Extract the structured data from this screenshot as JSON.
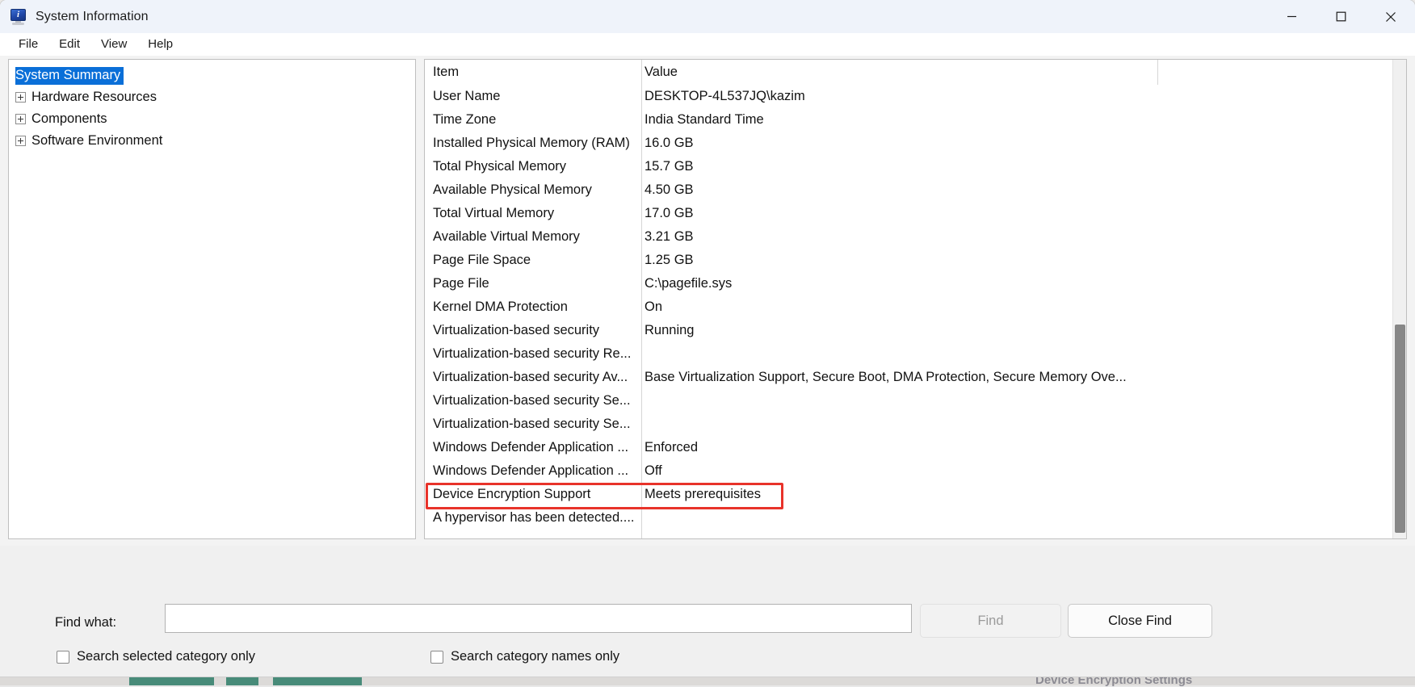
{
  "window": {
    "title": "System Information",
    "icon": "system-information-monitor-icon",
    "controls": {
      "minimize": "minimize-icon",
      "maximize": "maximize-icon",
      "close": "close-icon"
    }
  },
  "menu": {
    "items": [
      "File",
      "Edit",
      "View",
      "Help"
    ]
  },
  "tree": {
    "items": [
      {
        "label": "System Summary",
        "selected": true,
        "expandable": false
      },
      {
        "label": "Hardware Resources",
        "selected": false,
        "expandable": true
      },
      {
        "label": "Components",
        "selected": false,
        "expandable": true
      },
      {
        "label": "Software Environment",
        "selected": false,
        "expandable": true
      }
    ]
  },
  "table": {
    "columns": [
      "Item",
      "Value"
    ],
    "rows": [
      {
        "item": "User Name",
        "value": "DESKTOP-4L537JQ\\kazim"
      },
      {
        "item": "Time Zone",
        "value": "India Standard Time"
      },
      {
        "item": "Installed Physical Memory (RAM)",
        "value": "16.0 GB"
      },
      {
        "item": "Total Physical Memory",
        "value": "15.7 GB"
      },
      {
        "item": "Available Physical Memory",
        "value": "4.50 GB"
      },
      {
        "item": "Total Virtual Memory",
        "value": "17.0 GB"
      },
      {
        "item": "Available Virtual Memory",
        "value": "3.21 GB"
      },
      {
        "item": "Page File Space",
        "value": "1.25 GB"
      },
      {
        "item": "Page File",
        "value": "C:\\pagefile.sys"
      },
      {
        "item": "Kernel DMA Protection",
        "value": "On"
      },
      {
        "item": "Virtualization-based security",
        "value": "Running"
      },
      {
        "item": "Virtualization-based security Re...",
        "value": ""
      },
      {
        "item": "Virtualization-based security Av...",
        "value": "Base Virtualization Support, Secure Boot, DMA Protection, Secure Memory Ove..."
      },
      {
        "item": "Virtualization-based security Se...",
        "value": ""
      },
      {
        "item": "Virtualization-based security Se...",
        "value": ""
      },
      {
        "item": "Windows Defender Application ...",
        "value": "Enforced"
      },
      {
        "item": "Windows Defender Application ...",
        "value": "Off"
      },
      {
        "item": "Device Encryption Support",
        "value": "Meets prerequisites",
        "highlighted": true
      },
      {
        "item": "A hypervisor has been detected....",
        "value": ""
      }
    ]
  },
  "find": {
    "label": "Find what:",
    "value": "",
    "placeholder": "",
    "find_button": "Find",
    "close_button": "Close Find",
    "checkbox_selected_category": "Search selected category only",
    "checkbox_category_names": "Search category names only",
    "selected_category_checked": false,
    "category_names_checked": false
  },
  "annotation": {
    "color": "#e8332a",
    "target_row": "Device Encryption Support"
  },
  "background": {
    "ghost_text": "Device Encryption Settings"
  }
}
